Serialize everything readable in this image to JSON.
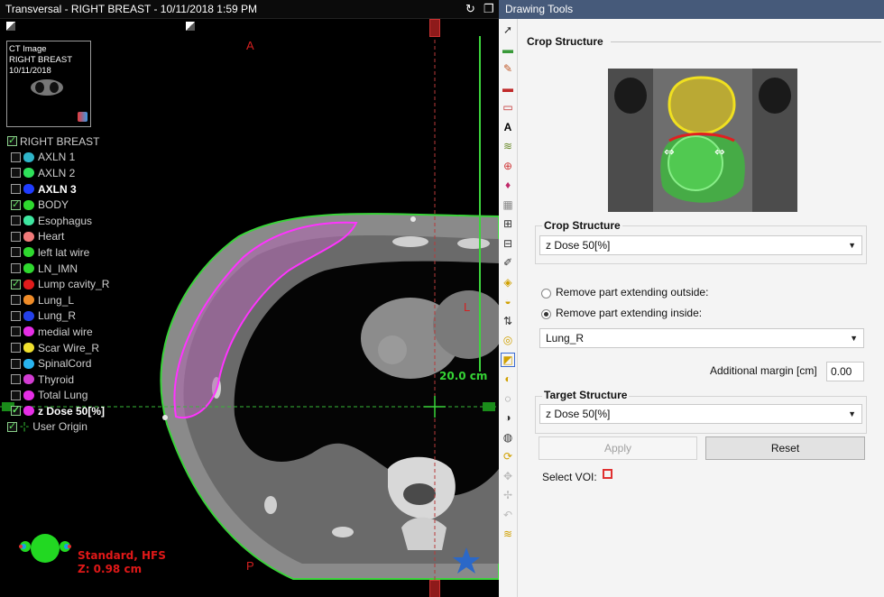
{
  "viewer": {
    "title": "Transversal - RIGHT BREAST - 10/11/2018 1:59 PM",
    "thumbnail": {
      "line1": "CT Image",
      "line2": "RIGHT BREAST",
      "line3": "10/11/2018"
    },
    "orientation": {
      "top": "A",
      "bottom": "P",
      "side": "L"
    },
    "scale_label": "20.0 cm",
    "patient_position": "Standard, HFS",
    "z_position": "Z: 0.98 cm",
    "plan_name": "RIGHT BREAST",
    "structures": [
      {
        "label": "AXLN 1",
        "checked": false,
        "color": "#2fb4c8",
        "bold": false
      },
      {
        "label": "AXLN 2",
        "checked": false,
        "color": "#2ee05a",
        "bold": false
      },
      {
        "label": "AXLN 3",
        "checked": false,
        "color": "#1f3cff",
        "bold": true
      },
      {
        "label": "BODY",
        "checked": true,
        "color": "#2ed82e",
        "bold": false
      },
      {
        "label": "Esophagus",
        "checked": false,
        "color": "#3ee6a0",
        "bold": false
      },
      {
        "label": "Heart",
        "checked": false,
        "color": "#f07a7a",
        "bold": false
      },
      {
        "label": "left lat wire",
        "checked": false,
        "color": "#2ed82e",
        "bold": false
      },
      {
        "label": "LN_IMN",
        "checked": false,
        "color": "#2ed82e",
        "bold": false
      },
      {
        "label": "Lump cavity_R",
        "checked": true,
        "color": "#e01b1b",
        "bold": false
      },
      {
        "label": "Lung_L",
        "checked": false,
        "color": "#f08c28",
        "bold": false
      },
      {
        "label": "Lung_R",
        "checked": false,
        "color": "#2440e8",
        "bold": false
      },
      {
        "label": "medial wire",
        "checked": false,
        "color": "#e62ee6",
        "bold": false
      },
      {
        "label": "Scar Wire_R",
        "checked": false,
        "color": "#f0e02e",
        "bold": false
      },
      {
        "label": "SpinalCord",
        "checked": false,
        "color": "#28b4f0",
        "bold": false
      },
      {
        "label": "Thyroid",
        "checked": false,
        "color": "#d23cd2",
        "bold": false
      },
      {
        "label": "Total Lung",
        "checked": false,
        "color": "#e62ee6",
        "bold": false
      },
      {
        "label": "z Dose 50[%]",
        "checked": true,
        "color": "#e62ee6",
        "bold": true
      }
    ],
    "user_origin": "User Origin"
  },
  "panel": {
    "title": "Drawing Tools",
    "heading": "Crop Structure",
    "crop_group_label": "Crop Structure",
    "crop_structure_value": "z Dose 50[%]",
    "option_outside": "Remove part extending outside:",
    "option_inside": "Remove part extending inside:",
    "selected_option": "inside",
    "reference_structure_value": "Lung_R",
    "margin_label": "Additional margin [cm]",
    "margin_value": "0.00",
    "target_group_label": "Target Structure",
    "target_structure_value": "z Dose 50[%]",
    "apply_label": "Apply",
    "reset_label": "Reset",
    "select_voi_label": "Select VOI:"
  }
}
